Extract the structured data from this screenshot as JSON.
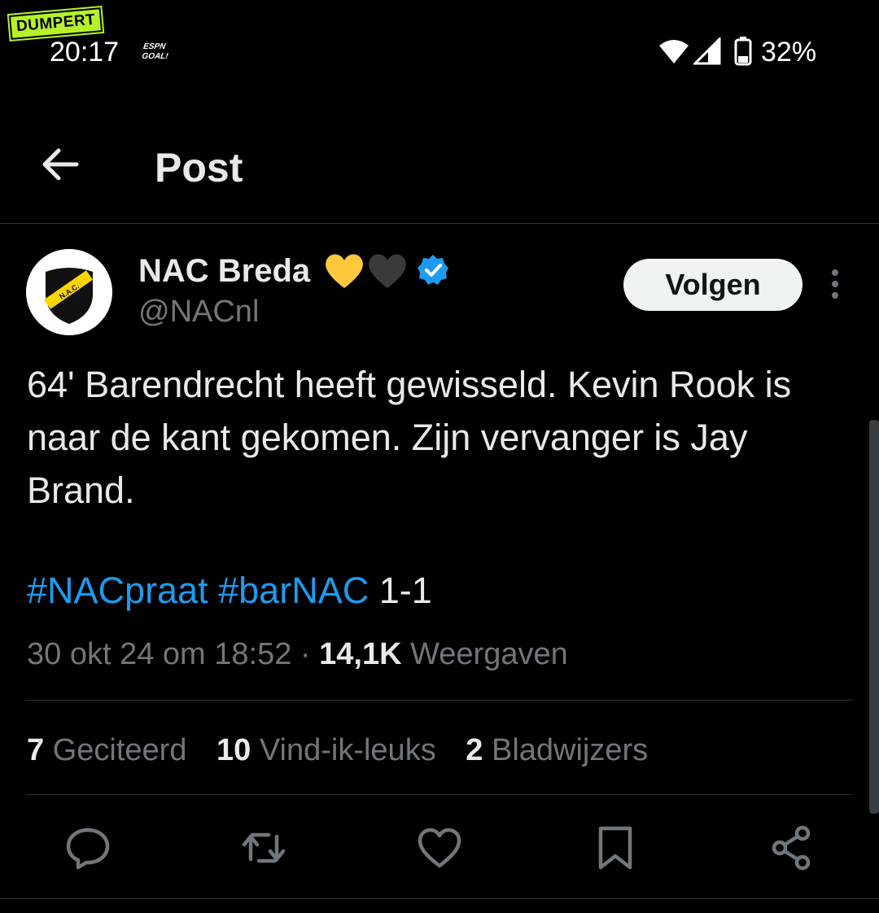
{
  "watermark": "DUMPERT",
  "status_bar": {
    "time": "20:17",
    "app_icon_text": "ESPN GOAL!",
    "battery_percent": "32%",
    "icons": [
      "wifi-icon",
      "signal-icon",
      "battery-icon"
    ]
  },
  "header": {
    "title": "Post",
    "back_icon": "arrow-left-icon"
  },
  "author": {
    "name": "NAC Breda",
    "emoji": [
      "yellow-heart",
      "black-heart"
    ],
    "verified": true,
    "handle": "@NACnl",
    "avatar_text": "N.A.C."
  },
  "follow_button": {
    "label": "Volgen"
  },
  "post": {
    "text": "64' Barendrecht heeft gewisseld. Kevin Rook is naar de kant gekomen. Zijn vervanger is Jay Brand.",
    "hashtag1": "#NACpraat",
    "hashtag2": "#barNAC",
    "score": "1-1",
    "timestamp": "30 okt 24 om 18:52",
    "separator": "·",
    "views_count": "14,1K",
    "views_label": "Weergaven"
  },
  "stats": {
    "quotes_count": "7",
    "quotes_label": "Geciteerd",
    "likes_count": "10",
    "likes_label": "Vind-ik-leuks",
    "bookmarks_count": "2",
    "bookmarks_label": "Bladwijzers"
  },
  "actions": [
    "reply-icon",
    "repost-icon",
    "like-icon",
    "bookmark-icon",
    "share-icon"
  ],
  "colors": {
    "background": "#000000",
    "text": "#e7e9ea",
    "muted": "#71767b",
    "link": "#1d9bf0",
    "verified": "#1d9bf0",
    "watermark": "#b6f22a",
    "heart_yellow": "#ffc83d"
  }
}
